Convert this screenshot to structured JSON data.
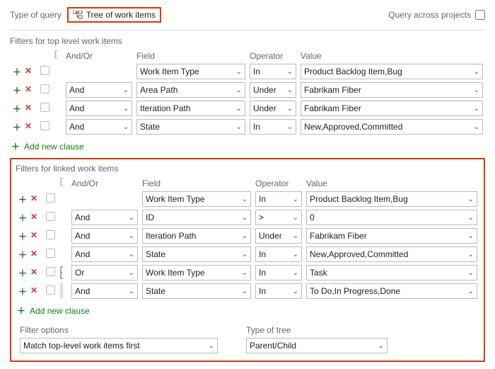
{
  "header": {
    "type_of_query_label": "Type of query",
    "query_type_value": "Tree of work items",
    "cross_projects_label": "Query across projects"
  },
  "sections": {
    "top": {
      "title": "Filters for top level work items",
      "headers": {
        "andor": "And/Or",
        "field": "Field",
        "operator": "Operator",
        "value": "Value"
      },
      "rows": [
        {
          "andor": "",
          "field": "Work Item Type",
          "operator": "In",
          "value": "Product Backlog Item,Bug"
        },
        {
          "andor": "And",
          "field": "Area Path",
          "operator": "Under",
          "value": "Fabrikam Fiber"
        },
        {
          "andor": "And",
          "field": "Iteration Path",
          "operator": "Under",
          "value": "Fabrikam Fiber"
        },
        {
          "andor": "And",
          "field": "State",
          "operator": "In",
          "value": "New,Approved,Committed"
        }
      ],
      "add_clause": "Add new clause"
    },
    "linked": {
      "title": "Filters for linked work items",
      "headers": {
        "andor": "And/Or",
        "field": "Field",
        "operator": "Operator",
        "value": "Value"
      },
      "rows": [
        {
          "andor": "",
          "field": "Work Item Type",
          "operator": "In",
          "value": "Product Backlog Item,Bug",
          "group": false,
          "indent": false
        },
        {
          "andor": "And",
          "field": "ID",
          "operator": ">",
          "value": "0",
          "group": false,
          "indent": false
        },
        {
          "andor": "And",
          "field": "Iteration Path",
          "operator": "Under",
          "value": "Fabrikam Fiber",
          "group": false,
          "indent": false
        },
        {
          "andor": "And",
          "field": "State",
          "operator": "In",
          "value": "New,Approved,Committed",
          "group": false,
          "indent": false
        },
        {
          "andor": "Or",
          "field": "Work Item Type",
          "operator": "In",
          "value": "Task",
          "group": true,
          "indent": false
        },
        {
          "andor": "And",
          "field": "State",
          "operator": "In",
          "value": "To Do,In Progress,Done",
          "group": false,
          "indent": true
        }
      ],
      "add_clause": "Add new clause"
    }
  },
  "options": {
    "filter_options_label": "Filter options",
    "filter_options_value": "Match top-level work items first",
    "type_of_tree_label": "Type of tree",
    "type_of_tree_value": "Parent/Child"
  }
}
